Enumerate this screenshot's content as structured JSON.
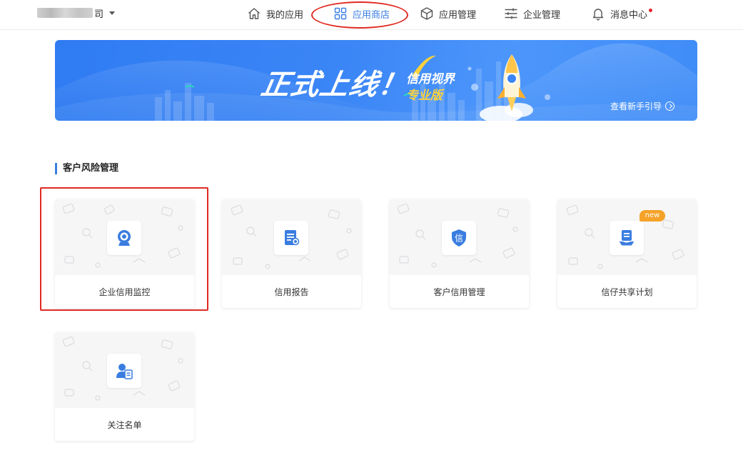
{
  "header": {
    "company_suffix": "司",
    "nav": [
      {
        "label": "我的应用",
        "icon": "home-icon"
      },
      {
        "label": "应用商店",
        "icon": "grid-icon",
        "active": true
      },
      {
        "label": "应用管理",
        "icon": "cube-icon"
      },
      {
        "label": "企业管理",
        "icon": "sliders-icon"
      },
      {
        "label": "消息中心",
        "icon": "bell-icon",
        "has_dot": true
      }
    ]
  },
  "banner": {
    "title": "正式上线！",
    "subtitle_line1": "信用视界",
    "subtitle_line2": "专业版",
    "guide_link": "查看新手引导"
  },
  "section": {
    "title": "客户风险管理"
  },
  "apps": [
    {
      "label": "企业信用监控",
      "icon": "camera-icon"
    },
    {
      "label": "信用报告",
      "icon": "report-icon"
    },
    {
      "label": "客户信用管理",
      "icon": "shield-xin-icon",
      "glyph": "信"
    },
    {
      "label": "信仔共享计划",
      "icon": "share-plan-icon",
      "badge": "new"
    },
    {
      "label": "关注名单",
      "icon": "watchlist-icon"
    }
  ],
  "colors": {
    "accent": "#3a7de0",
    "banner_blue": "#3b86f6",
    "highlight_red": "#e02a22",
    "badge_orange": "#f5a228",
    "message_dot": "#e5242a"
  }
}
